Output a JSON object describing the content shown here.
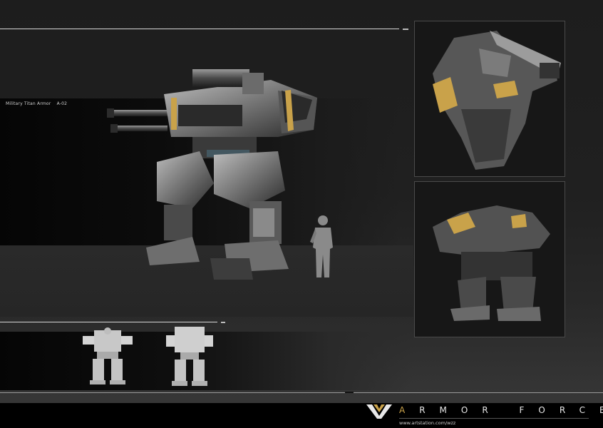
{
  "header": {
    "title": "Military Titan Armor",
    "code": "A-02"
  },
  "footer": {
    "brand_letters": "ARMOR FORCE",
    "brand_accent": "A",
    "brand_rest": "RMOR  FORCE",
    "url": "www.artstation.com/wzz"
  },
  "colors": {
    "accent": "#c9a24a",
    "background": "#1f1f1f",
    "footer_bg": "#000000"
  },
  "icons": {
    "logo": "v-chevron-logo-icon",
    "human_scale": "soldier-silhouette-icon",
    "front_view": "mech-front-orthographic-icon",
    "back_view": "mech-back-orthographic-icon"
  }
}
